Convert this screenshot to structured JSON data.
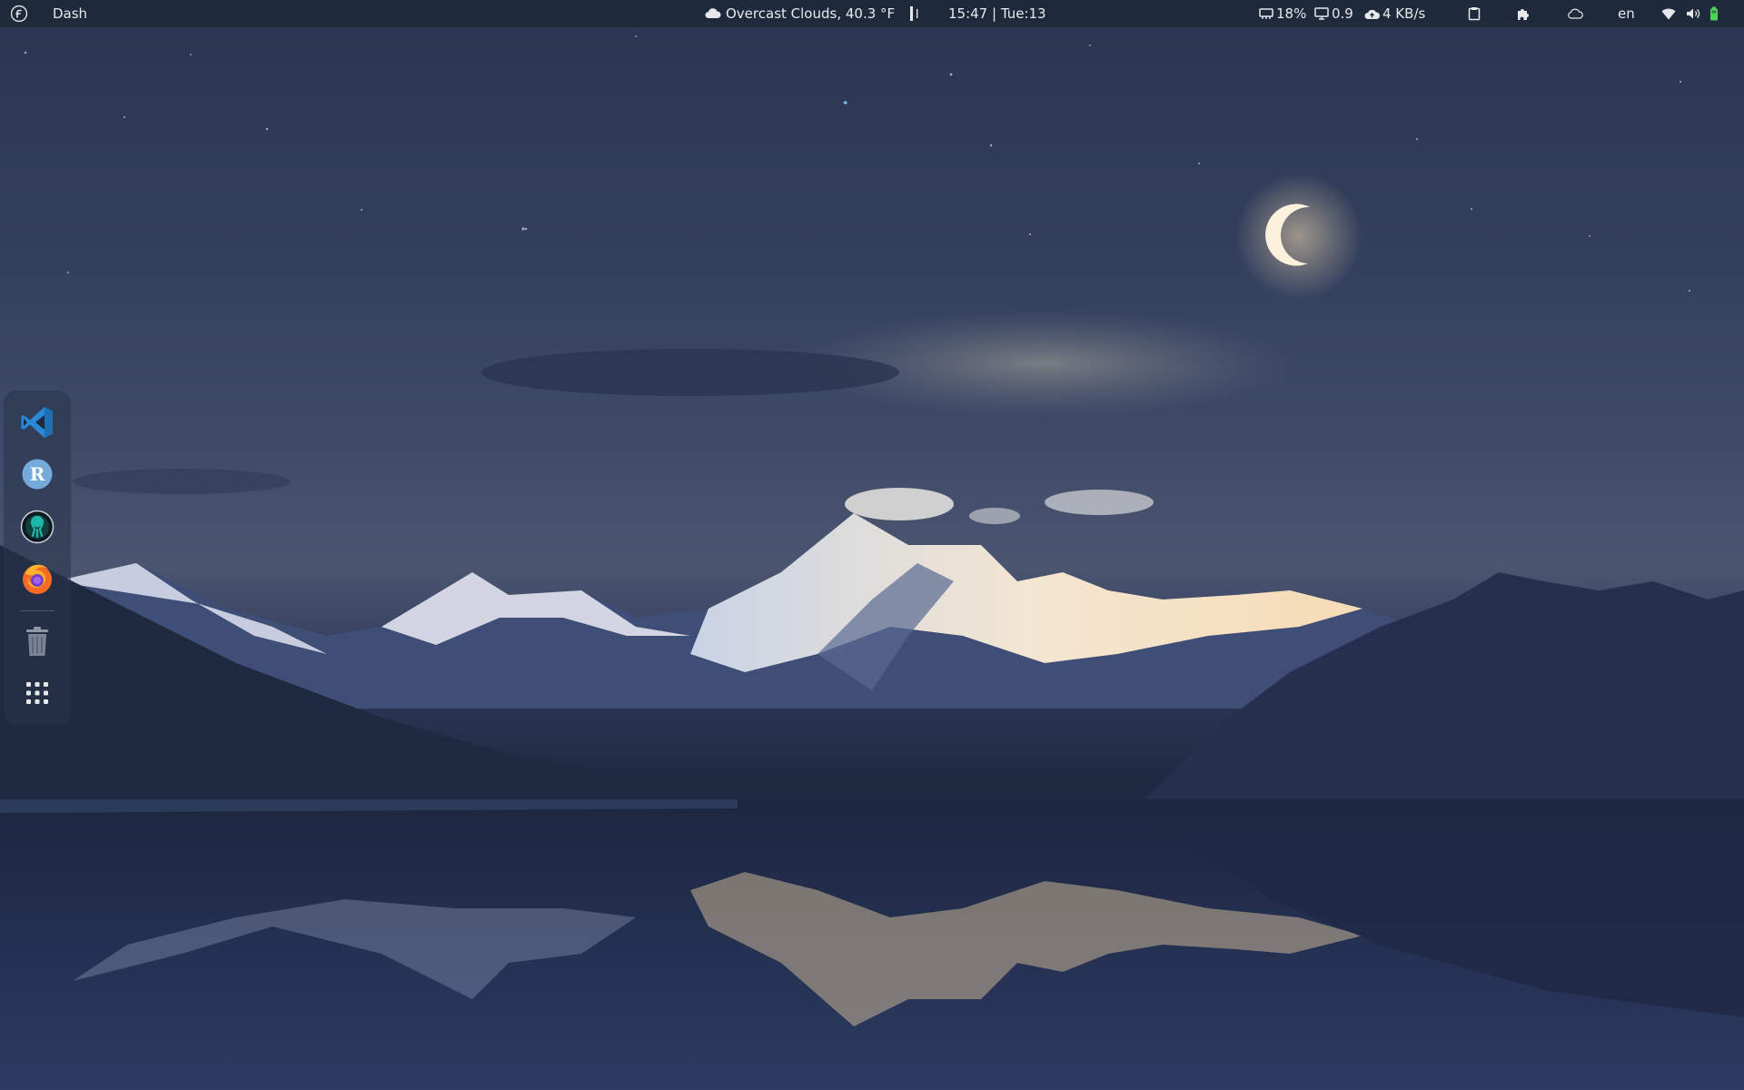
{
  "topbar": {
    "activities_label": "Dash",
    "weather": "Overcast Clouds, 40.3 °F",
    "clock": "15:47 | Tue:13",
    "cpu": "18%",
    "load": "0.9",
    "network": "4 KB/s",
    "language": "en"
  },
  "icons": {
    "logo": "fedora-logo-icon",
    "weather": "cloud-weather-icon",
    "cpu": "cpu-icon",
    "load": "monitor-icon",
    "network": "cloud-upload-icon",
    "clipboard": "clipboard-icon",
    "extensions": "puzzle-icon",
    "cloud": "cloud-outline-icon",
    "wifi": "wifi-icon",
    "volume": "volume-icon",
    "battery": "battery-icon"
  },
  "dock": {
    "apps": [
      {
        "name": "Visual Studio Code",
        "icon": "vscode-icon"
      },
      {
        "name": "RStudio",
        "icon": "rstudio-icon",
        "letter": "R"
      },
      {
        "name": "GitKraken",
        "icon": "gitkraken-icon"
      },
      {
        "name": "Firefox",
        "icon": "firefox-icon"
      }
    ],
    "trash": {
      "icon": "trash-icon"
    },
    "app_grid": {
      "icon": "app-grid-icon"
    }
  },
  "colors": {
    "topbar_bg": "#1e2a3c",
    "vscode_blue": "#2a8ad8",
    "rstudio_blue": "#75aadb",
    "gitkraken_teal": "#1fb8a8",
    "firefox_orange": "#f56b26"
  }
}
